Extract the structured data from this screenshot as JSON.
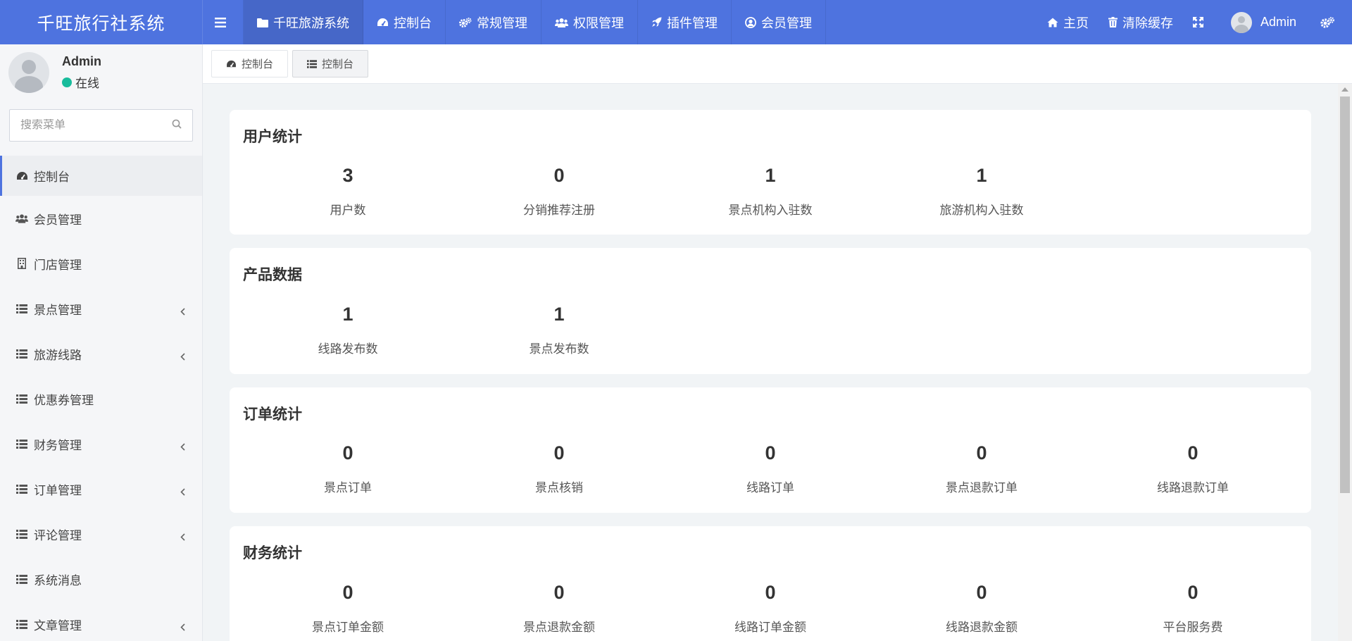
{
  "app": {
    "title": "千旺旅行社系统"
  },
  "header": {
    "nav": [
      {
        "label": "千旺旅游系统",
        "icon": "folder-icon"
      },
      {
        "label": "控制台",
        "icon": "dashboard-icon"
      },
      {
        "label": "常规管理",
        "icon": "cogs-icon"
      },
      {
        "label": "权限管理",
        "icon": "users-icon"
      },
      {
        "label": "插件管理",
        "icon": "rocket-icon"
      },
      {
        "label": "会员管理",
        "icon": "user-circle-icon"
      }
    ],
    "right": {
      "home": "主页",
      "clear_cache": "清除缓存",
      "user": "Admin"
    }
  },
  "sidebar": {
    "user": {
      "name": "Admin",
      "status": "在线"
    },
    "search_placeholder": "搜索菜单",
    "items": [
      {
        "label": "控制台",
        "icon": "dashboard-icon",
        "active": true,
        "has_sub": false
      },
      {
        "label": "会员管理",
        "icon": "users-icon",
        "has_sub": false
      },
      {
        "label": "门店管理",
        "icon": "building-icon",
        "has_sub": false
      },
      {
        "label": "景点管理",
        "icon": "list-icon",
        "has_sub": true
      },
      {
        "label": "旅游线路",
        "icon": "list-icon",
        "has_sub": true
      },
      {
        "label": "优惠券管理",
        "icon": "list-icon",
        "has_sub": false
      },
      {
        "label": "财务管理",
        "icon": "list-icon",
        "has_sub": true
      },
      {
        "label": "订单管理",
        "icon": "list-icon",
        "has_sub": true
      },
      {
        "label": "评论管理",
        "icon": "list-icon",
        "has_sub": true
      },
      {
        "label": "系统消息",
        "icon": "list-icon",
        "has_sub": false
      },
      {
        "label": "文章管理",
        "icon": "list-icon",
        "has_sub": true
      }
    ]
  },
  "tabs": [
    {
      "label": "控制台",
      "icon": "dashboard-icon"
    },
    {
      "label": "控制台",
      "icon": "list-icon",
      "active": true
    }
  ],
  "sections": [
    {
      "title": "用户统计",
      "stats": [
        {
          "value": "3",
          "label": "用户数"
        },
        {
          "value": "0",
          "label": "分销推荐注册"
        },
        {
          "value": "1",
          "label": "景点机构入驻数"
        },
        {
          "value": "1",
          "label": "旅游机构入驻数"
        }
      ]
    },
    {
      "title": "产品数据",
      "stats": [
        {
          "value": "1",
          "label": "线路发布数"
        },
        {
          "value": "1",
          "label": "景点发布数"
        }
      ]
    },
    {
      "title": "订单统计",
      "stats": [
        {
          "value": "0",
          "label": "景点订单"
        },
        {
          "value": "0",
          "label": "景点核销"
        },
        {
          "value": "0",
          "label": "线路订单"
        },
        {
          "value": "0",
          "label": "景点退款订单"
        },
        {
          "value": "0",
          "label": "线路退款订单"
        }
      ]
    },
    {
      "title": "财务统计",
      "stats": [
        {
          "value": "0",
          "label": "景点订单金额"
        },
        {
          "value": "0",
          "label": "景点退款金额"
        },
        {
          "value": "0",
          "label": "线路订单金额"
        },
        {
          "value": "0",
          "label": "线路退款金额"
        },
        {
          "value": "0",
          "label": "平台服务费"
        }
      ]
    }
  ],
  "colors": {
    "primary": "#4e73df",
    "online": "#18bc9c",
    "background": "#f1f4f6"
  }
}
